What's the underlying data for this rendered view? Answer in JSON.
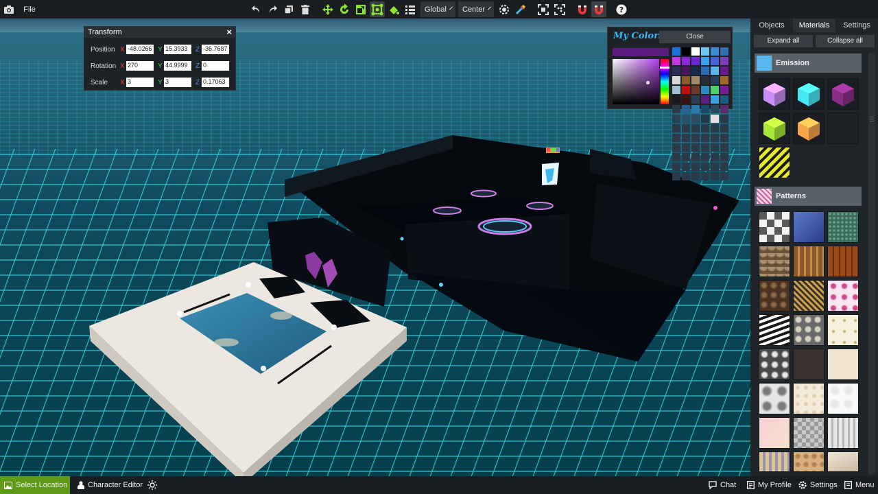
{
  "menu": {
    "file_label": "File"
  },
  "toolbar": {
    "space_label": "Global",
    "pivot_label": "Center"
  },
  "transform": {
    "title": "Transform",
    "position": {
      "label": "Position",
      "x": "-48.0266",
      "y": "15.3933",
      "z": "-36.7687"
    },
    "rotation": {
      "label": "Rotation",
      "x": "270",
      "y": "44.9999",
      "z": "0"
    },
    "scale": {
      "label": "Scale",
      "x": "3",
      "y": "3",
      "z": "0.17063"
    },
    "axis_labels": {
      "x": "X",
      "y": "Y",
      "z": "Z"
    }
  },
  "colors": {
    "title": "My Colors",
    "close_label": "Close",
    "current": "#5a1c7f",
    "swatches": [
      "#1a73d9",
      "#000000",
      "#ffffff",
      "#6ec6f0",
      "#3d8bd1",
      "#2f6fb0",
      "#c03ae0",
      "#8a2bd6",
      "#6a2ad0",
      "#3aa0ea",
      "#4a62d8",
      "#7a3fb5",
      "#2b2f52",
      "#4a1458",
      "#1a2a4a",
      "#2a6cb8",
      "#5bb6f0",
      "#6a1a90",
      "#d8d8d8",
      "#8a5a2a",
      "#a08a6a",
      "#2a2f35",
      "#2a3f55",
      "#a06a2a",
      "#a0c0d0",
      "#c01010",
      "#6a3a2a",
      "#2f8ac0",
      "#4ad06a",
      "#7a1a9a",
      "#1a1a1a",
      "#3a1010",
      "#2a4050",
      "#5a2080",
      "#3aa0e0",
      "#1a5a80",
      "#2a3a48",
      "#2a6090",
      "#2a7ab0",
      "#1a4a6a",
      "#2a4a60",
      "#5a2a70",
      "#2a4258",
      "#2a5070",
      "#304a60",
      "#20384a",
      "#e0e0e0",
      "#2a3a48",
      "#2a3a48",
      "#2a3a48",
      "#2a3a48",
      "#2a3a48",
      "#2a3a48",
      "#2a3a48",
      "#2a3a48",
      "#2a3a48",
      "#2a3a48",
      "#2a3a48",
      "#2a3a48",
      "#2a3a48",
      "#2a3a48",
      "#2a3a48",
      "#2a3a48",
      "#2a3a48",
      "#2a3a48",
      "#2a3a48",
      "#2a3a48",
      "#2a3a48",
      "#2a3a48",
      "#2a3a48",
      "#2a3a48",
      "#2a3a48",
      "#2a3a48",
      "#2a3a48",
      "#2a3a48",
      "#2a3a48",
      "#2a3a48",
      "#2a3a48",
      "#2a3a48",
      "#2a3a48",
      "#2a3a48",
      "#2a3a48",
      "#2a3a48",
      "#2a3a48",
      "#2a3a48",
      "#2a3a48",
      "#2a3a48",
      "#2a3a48",
      "#2a3a48",
      "#2a3a48",
      "#3a88c8",
      "#2a3a48",
      "#3a98d8",
      "#2a3a48",
      "#2a3a48",
      "#2a3a48"
    ]
  },
  "right_panel": {
    "tabs": [
      "Objects",
      "Materials",
      "Settings"
    ],
    "active_tab": "Materials",
    "expand_all_label": "Expand all",
    "collapse_all_label": "Collapse all",
    "emission": {
      "label": "Emission",
      "swatch_color": "#5ab8f0",
      "cube_colors": [
        "#c98ef5",
        "#47e8f5",
        "#8a2f86",
        "#a7e838",
        "#f8a64a"
      ]
    },
    "patterns": {
      "label": "Patterns",
      "items": [
        "checkerboard-marble",
        "blue-tile",
        "green-mosaic",
        "scale-pattern",
        "wicker-weave",
        "wood-planks",
        "stone-ring",
        "gold-diagonal",
        "floral-pink",
        "zebra",
        "hexagon-grey",
        "cream-dots",
        "damask-dark",
        "chinese-script-dark",
        "chinese-script-light",
        "damask-light",
        "cream-polka",
        "white-floral",
        "pink-pastel",
        "grey-diamond",
        "silver-stripes",
        "pastel-stripes",
        "tan-ornament",
        "beige-fabric"
      ]
    }
  },
  "bottom_bar": {
    "select_location_label": "Select Location",
    "character_editor_label": "Character Editor",
    "chat_label": "Chat",
    "my_profile_label": "My Profile",
    "settings_label": "Settings",
    "menu_label": "Menu"
  }
}
